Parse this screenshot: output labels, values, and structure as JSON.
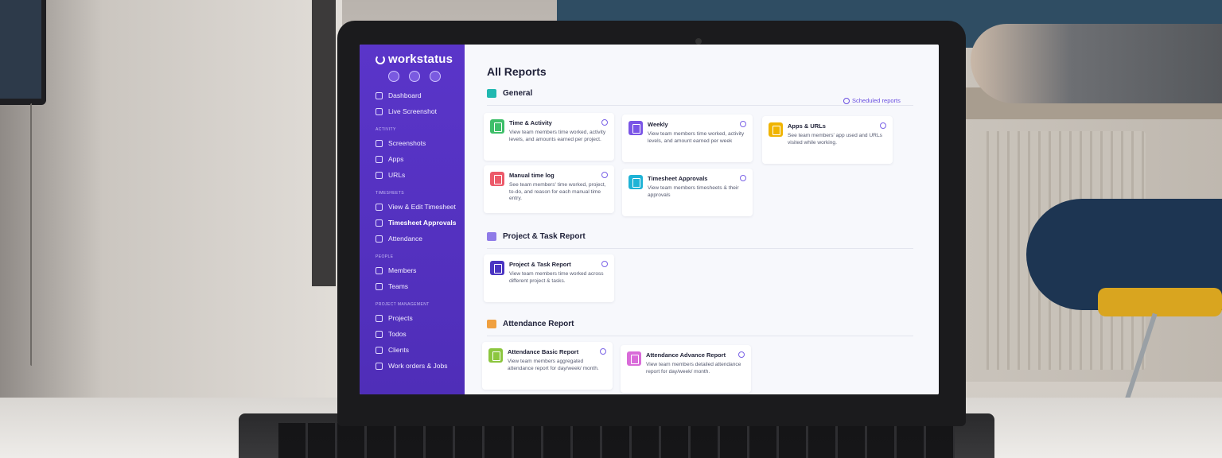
{
  "app": {
    "logo_text": "workstatus",
    "page_title": "All Reports",
    "scheduled_reports_label": "Scheduled reports",
    "accent_color": "#5a35c9"
  },
  "sidebar": {
    "top_items": [
      {
        "label": "Dashboard",
        "icon": "dashboard-icon"
      },
      {
        "label": "Live Screenshot",
        "icon": "screenshot-icon"
      }
    ],
    "sections": [
      {
        "title": "ACTIVITY",
        "items": [
          {
            "label": "Screenshots",
            "icon": "screenshots-icon"
          },
          {
            "label": "Apps",
            "icon": "apps-icon"
          },
          {
            "label": "URLs",
            "icon": "urls-icon"
          }
        ]
      },
      {
        "title": "TIMESHEETS",
        "items": [
          {
            "label": "View & Edit Timesheet",
            "icon": "timesheet-icon"
          },
          {
            "label": "Timesheet Approvals",
            "icon": "approvals-icon"
          },
          {
            "label": "Attendance",
            "icon": "attendance-icon"
          }
        ]
      },
      {
        "title": "PEOPLE",
        "items": [
          {
            "label": "Members",
            "icon": "members-icon"
          },
          {
            "label": "Teams",
            "icon": "teams-icon"
          }
        ]
      },
      {
        "title": "PROJECT MANAGEMENT",
        "items": [
          {
            "label": "Projects",
            "icon": "projects-icon"
          },
          {
            "label": "Todos",
            "icon": "todos-icon"
          },
          {
            "label": "Clients",
            "icon": "clients-icon"
          },
          {
            "label": "Work orders & Jobs",
            "icon": "work-orders-icon"
          }
        ]
      }
    ]
  },
  "reports": {
    "general": {
      "title": "General",
      "cards": [
        {
          "title": "Time & Activity",
          "desc": "View team members time worked, activity levels, and amounts earned per project.",
          "color": "#3fbf6a"
        },
        {
          "title": "Weekly",
          "desc": "View team members time worked, activity levels, and amount earned per week",
          "color": "#7a55e6"
        },
        {
          "title": "Apps & URLs",
          "desc": "See team members' app used and URLs visited while working.",
          "color": "#f0b400"
        },
        {
          "title": "Manual time log",
          "desc": "See team members' time worked, project, to-do, and reason for each manual time entry.",
          "color": "#ec5a6a"
        },
        {
          "title": "Timesheet Approvals",
          "desc": "View team members timesheets & their approvals",
          "color": "#1fb3d6"
        }
      ]
    },
    "project_task": {
      "title": "Project & Task Report",
      "cards": [
        {
          "title": "Project & Task Report",
          "desc": "View team members time worked across different project & tasks.",
          "color": "#4b35c2"
        }
      ]
    },
    "attendance": {
      "title": "Attendance Report",
      "cards": [
        {
          "title": "Attendance Basic Report",
          "desc": "View team members aggregated attendance report for day/week/ month.",
          "color": "#8cc63f"
        },
        {
          "title": "Attendance Advance Report",
          "desc": "View team members detailed attendance report for day/week/ month.",
          "color": "#d96bd9"
        }
      ]
    }
  }
}
